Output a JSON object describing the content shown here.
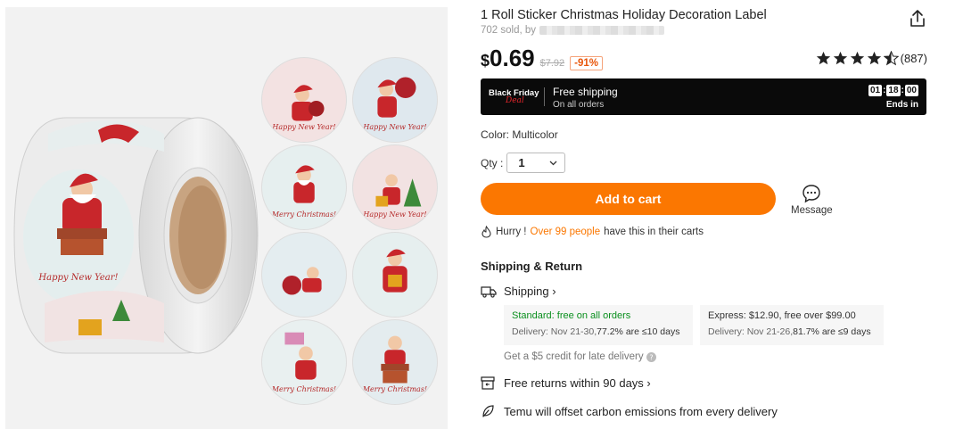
{
  "product": {
    "title": "1 Roll Sticker Christmas Holiday Decoration Label",
    "sold_prefix": "702 sold, by",
    "currency": "$",
    "price": "0.69",
    "original_price": "$7.92",
    "discount": "-91%",
    "rating_count": "(887)",
    "rating_value": 4.5
  },
  "promo": {
    "logo_line": "Black Friday",
    "logo_script": "Deal",
    "shipping_title": "Free shipping",
    "shipping_sub": "On all orders",
    "timer": [
      "01",
      "18",
      "00"
    ],
    "ends_label": "Ends in"
  },
  "options": {
    "color_label": "Color: Multicolor",
    "qty_label": "Qty :",
    "qty_value": "1"
  },
  "actions": {
    "add_to_cart": "Add to cart",
    "message": "Message"
  },
  "hurry": {
    "prefix": "Hurry !",
    "highlight": "Over 99 people",
    "suffix": "have this in their carts"
  },
  "shipping": {
    "section_title": "Shipping & Return",
    "shipping_link": "Shipping ›",
    "standard": {
      "title": "Standard: free on all orders",
      "delivery": "Delivery: Nov 21-30,",
      "stat": "77.2% are ≤10 days"
    },
    "express": {
      "title": "Express: $12.90, free over $99.00",
      "delivery": "Delivery: Nov 21-26,",
      "stat": "81.7% are ≤9 days"
    },
    "credit": "Get a $5 credit for late delivery",
    "returns": "Free returns within 90 days ›",
    "carbon": "Temu will offset carbon emissions from every delivery"
  },
  "stickers": {
    "greet_a": "Happy New Year!",
    "greet_b": "Merry Christmas!"
  },
  "colors": {
    "accent": "#fb7701",
    "green": "#0a8f1e",
    "bar": "#0a0a0a"
  }
}
